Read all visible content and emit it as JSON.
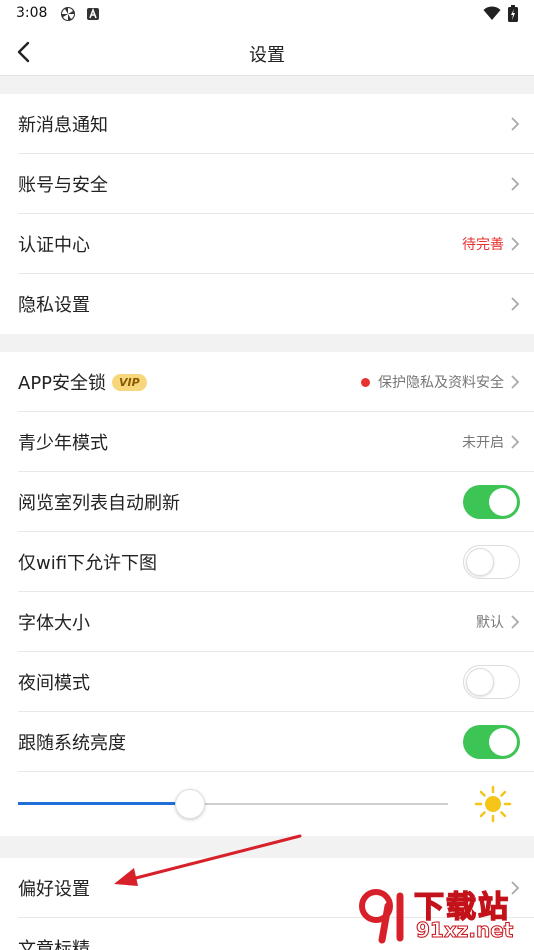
{
  "status_bar": {
    "time": "3:08"
  },
  "nav": {
    "title": "设置"
  },
  "group1": [
    {
      "label": "新消息通知",
      "value": ""
    },
    {
      "label": "账号与安全",
      "value": ""
    },
    {
      "label": "认证中心",
      "value": "待完善"
    },
    {
      "label": "隐私设置",
      "value": ""
    }
  ],
  "group2": {
    "app_lock": {
      "label": "APP安全锁",
      "badge": "VIP",
      "value": "保护隐私及资料安全"
    },
    "teen_mode": {
      "label": "青少年模式",
      "value": "未开启"
    },
    "auto_refresh": {
      "label": "阅览室列表自动刷新",
      "enabled": true
    },
    "wifi_images": {
      "label": "仅wifi下允许下图",
      "enabled": false
    },
    "font_size": {
      "label": "字体大小",
      "value": "默认"
    },
    "night_mode": {
      "label": "夜间模式",
      "enabled": false
    },
    "follow_brightness": {
      "label": "跟随系统亮度",
      "enabled": true
    },
    "brightness_level": 0.4
  },
  "group3": [
    {
      "label": "偏好设置"
    },
    {
      "label": "文章标精"
    }
  ],
  "watermark": {
    "line1": "下载站",
    "line2": "91xz.net"
  },
  "colors": {
    "toggle_on": "#3cc454",
    "accent_red": "#e8322f",
    "slider_blue": "#1e6fd9"
  }
}
